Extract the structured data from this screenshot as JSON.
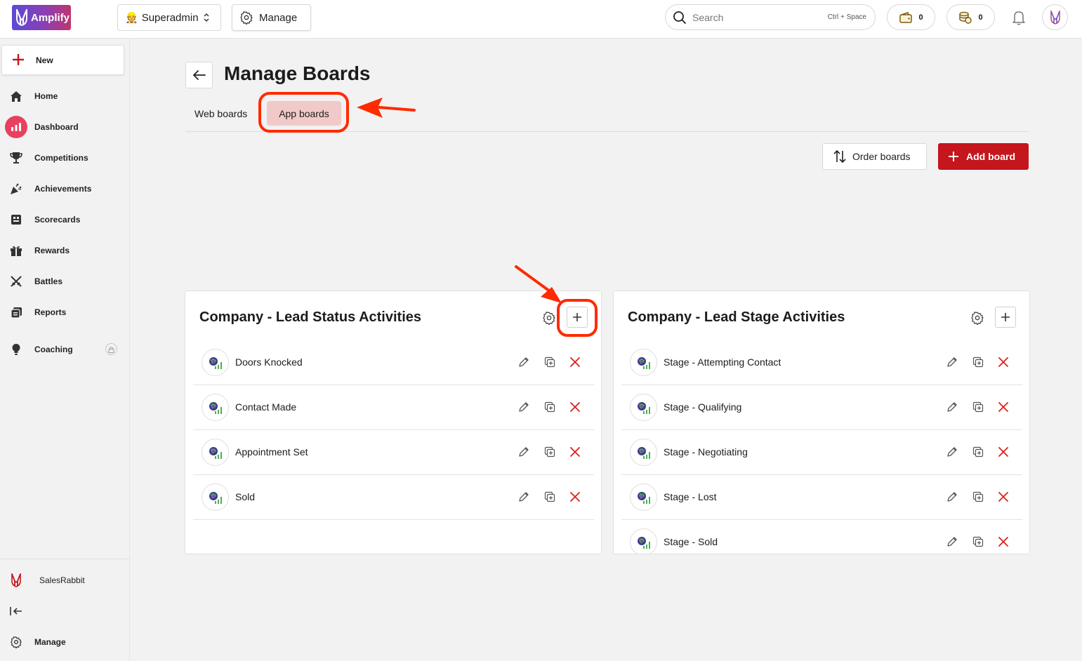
{
  "topbar": {
    "logo_text": "Amplify",
    "user_label": "Superadmin",
    "user_emoji": "👷",
    "manage_label": "Manage",
    "search_placeholder": "Search",
    "search_shortcut": "Ctrl + Space",
    "wallet_count": "0",
    "coins_count": "0"
  },
  "sidebar": {
    "new_label": "New",
    "items": [
      {
        "label": "Home",
        "icon": "home-icon"
      },
      {
        "label": "Dashboard",
        "icon": "chart-icon"
      },
      {
        "label": "Competitions",
        "icon": "trophy-icon"
      },
      {
        "label": "Achievements",
        "icon": "party-icon"
      },
      {
        "label": "Scorecards",
        "icon": "scorecard-icon"
      },
      {
        "label": "Rewards",
        "icon": "gift-icon"
      },
      {
        "label": "Battles",
        "icon": "swords-icon"
      },
      {
        "label": "Reports",
        "icon": "reports-icon"
      },
      {
        "label": "Coaching",
        "icon": "bulb-icon"
      }
    ],
    "footer": {
      "company_label": "SalesRabbit",
      "manage_label": "Manage"
    }
  },
  "main": {
    "title": "Manage Boards",
    "tabs": [
      {
        "label": "Web boards",
        "selected": false
      },
      {
        "label": "App boards",
        "selected": true
      }
    ],
    "order_label": "Order boards",
    "add_label": "Add board",
    "boards": [
      {
        "title": "Company - Lead Status Activities",
        "items": [
          "Doors Knocked",
          "Contact Made",
          "Appointment Set",
          "Sold"
        ]
      },
      {
        "title": "Company - Lead Stage Activities",
        "items": [
          "Stage - Attempting Contact",
          "Stage - Qualifying",
          "Stage - Negotiating",
          "Stage - Lost",
          "Stage - Sold"
        ]
      }
    ]
  },
  "colors": {
    "brand_red": "#c4161c",
    "active_nav": "#e8405f",
    "tab_selected_bg": "#f2c9c9",
    "annotation": "#ff2a00"
  }
}
